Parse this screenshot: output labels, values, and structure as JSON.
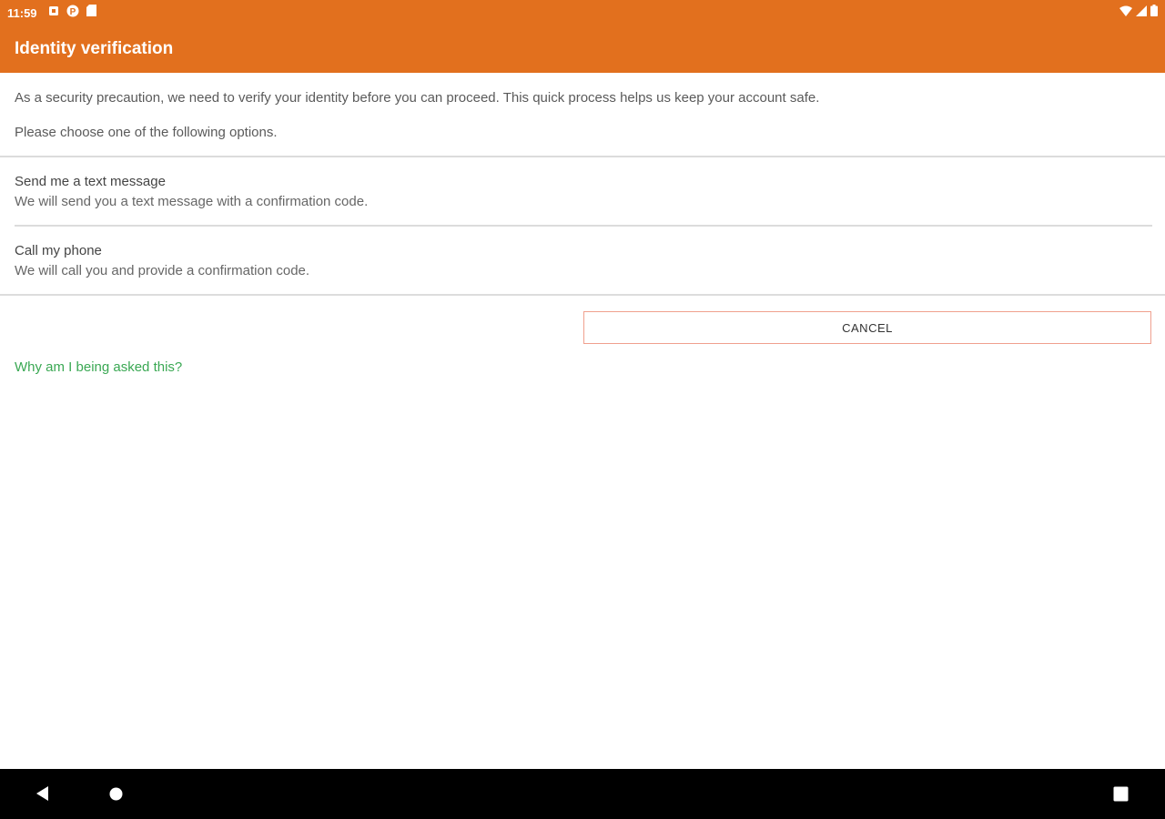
{
  "status_bar": {
    "time": "11:59",
    "left_icons": [
      "notification-icon",
      "p-badge-icon",
      "sd-card-icon"
    ],
    "right_icons": [
      "wifi-icon",
      "signal-icon",
      "battery-icon"
    ]
  },
  "app_bar": {
    "title": "Identity verification",
    "color": "#E2701E"
  },
  "intro": {
    "message": "As a security precaution, we need to verify your identity before you can proceed. This quick process helps us keep your account safe.",
    "prompt": "Please choose one of the following options."
  },
  "options": [
    {
      "title": "Send me a text message",
      "subtitle": "We will send you a text message with a confirmation code."
    },
    {
      "title": "Call my phone",
      "subtitle": "We will call you and provide a confirmation code."
    }
  ],
  "cancel_label": "CANCEL",
  "why_link": "Why am I being asked this?",
  "nav_bar": {
    "icons": [
      "back-icon",
      "home-icon",
      "recents-icon"
    ]
  }
}
